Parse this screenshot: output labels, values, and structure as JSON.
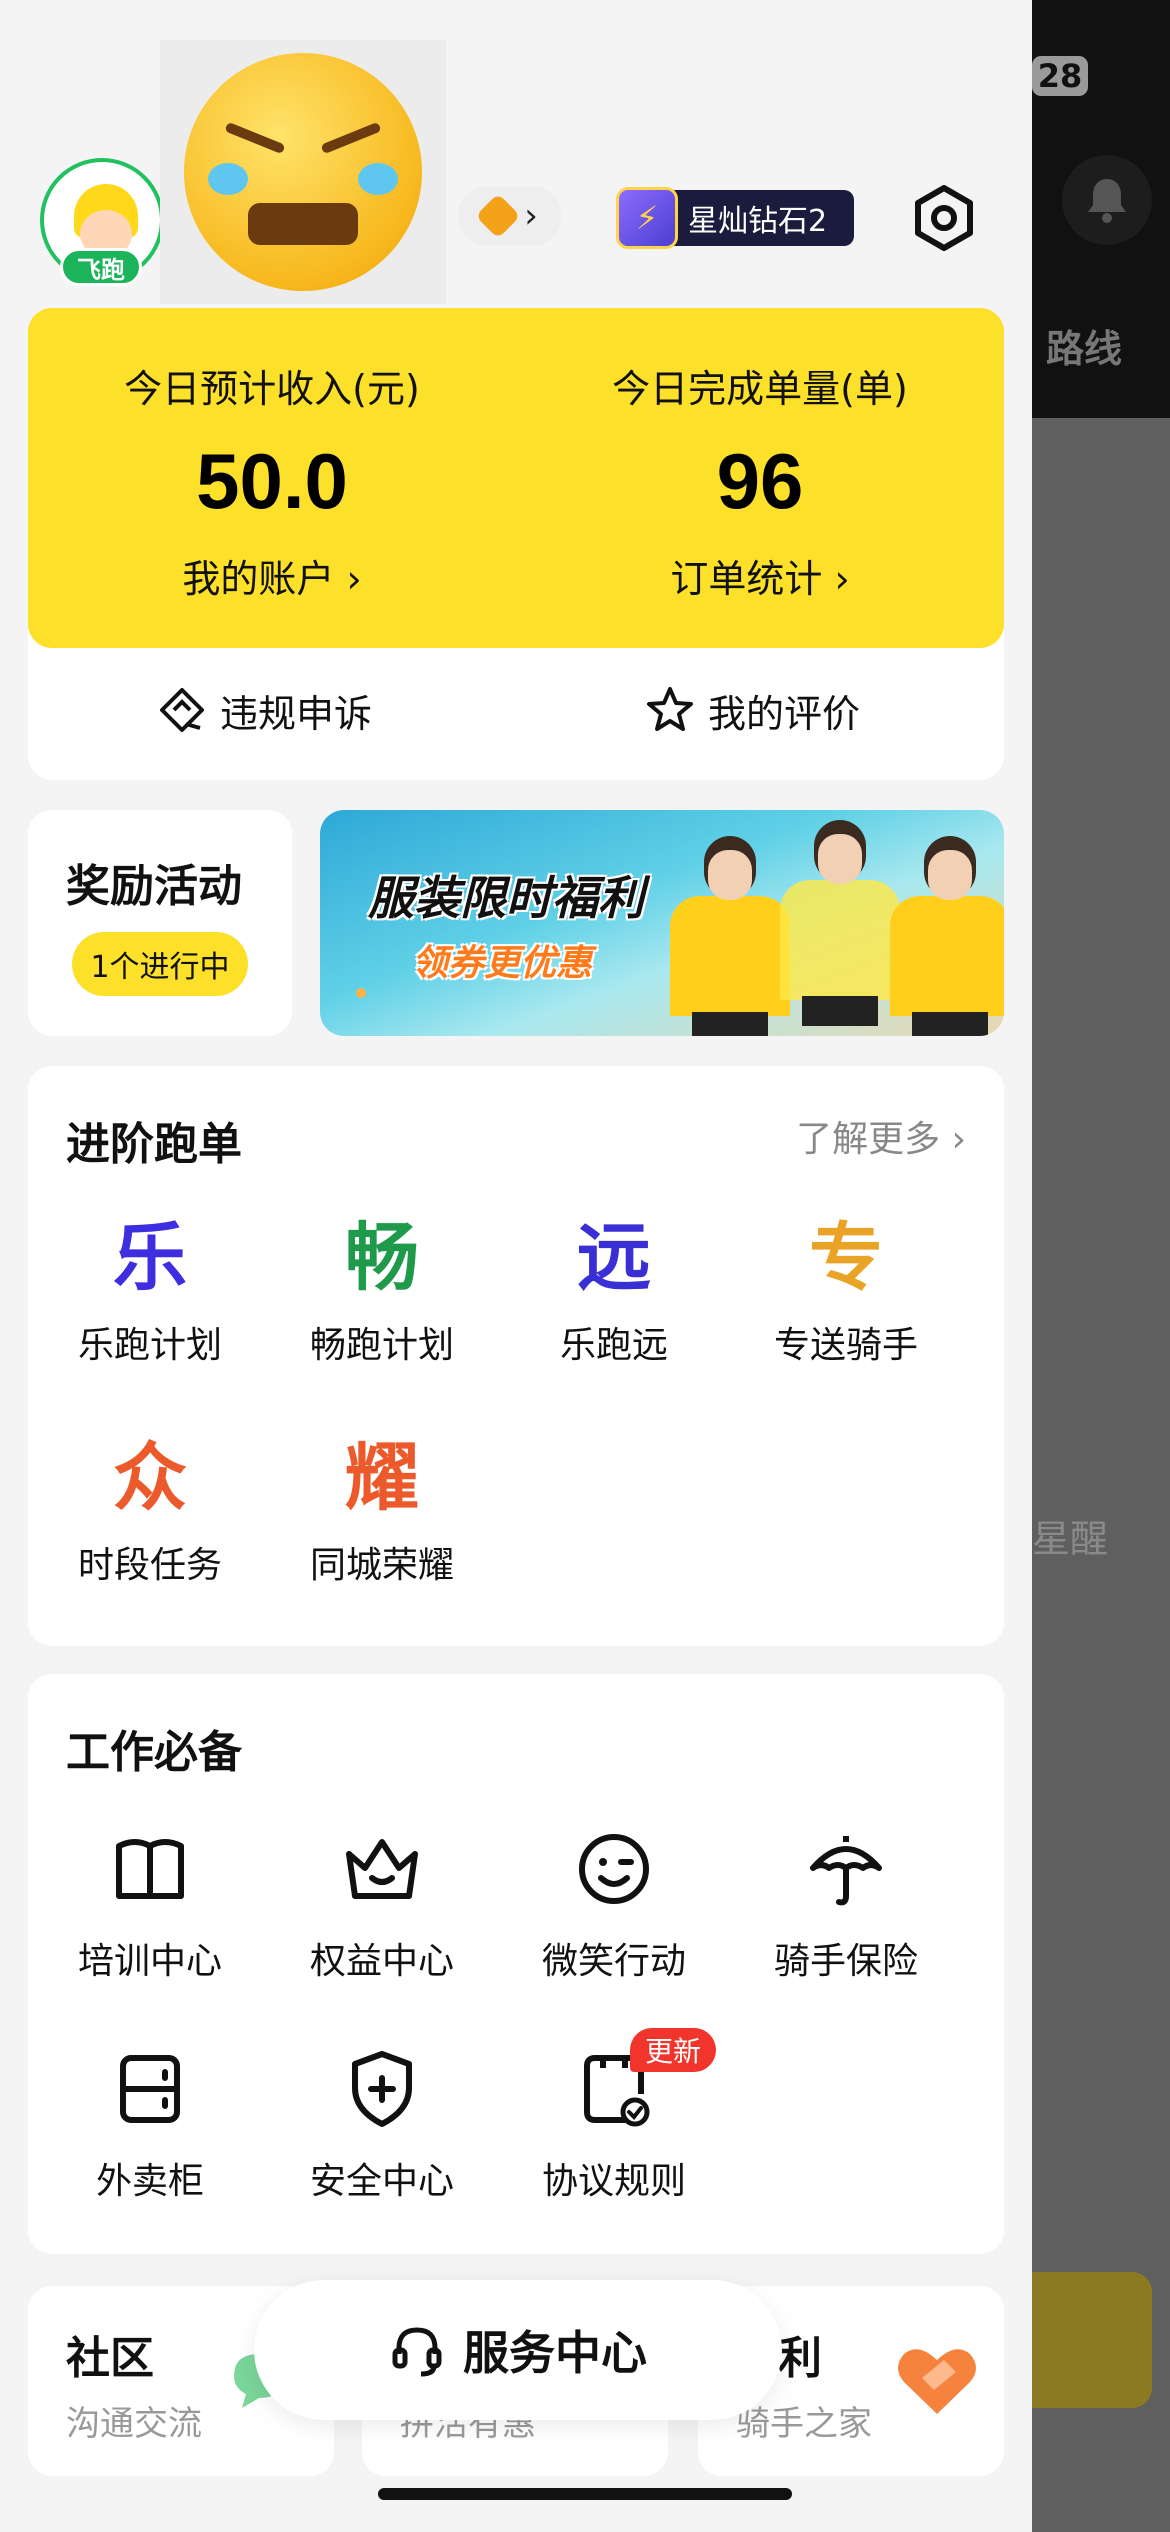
{
  "underlay": {
    "status_battery": "28",
    "route_text": "路线",
    "remind_text": "星醒"
  },
  "header": {
    "avatar_badge": "飞跑",
    "rank_label": "星灿钻石2",
    "level_chevron": "›"
  },
  "stats": {
    "income_label": "今日预计收入(元)",
    "income_value": "50.0",
    "account_link": "我的账户 ›",
    "orders_label": "今日完成单量(单)",
    "orders_value": "96",
    "orders_link": "订单统计 ›"
  },
  "actions": {
    "appeal": "违规申诉",
    "reviews": "我的评价"
  },
  "reward": {
    "title": "奖励活动",
    "pill": "1个进行中"
  },
  "banner": {
    "headline": "服装限时福利",
    "subline": "领券更优惠"
  },
  "advanced": {
    "title": "进阶跑单",
    "more": "了解更多 ›",
    "items": [
      {
        "glyph": "乐",
        "label": "乐跑计划",
        "color": "#3d2ee0"
      },
      {
        "glyph": "畅",
        "label": "畅跑计划",
        "color": "#1f9a4a"
      },
      {
        "glyph": "远",
        "label": "乐跑远",
        "color": "#3a2fd4"
      },
      {
        "glyph": "专",
        "label": "专送骑手",
        "color": "#e9a428"
      },
      {
        "glyph": "众",
        "label": "时段任务",
        "color": "#ec5a2c"
      },
      {
        "glyph": "耀",
        "label": "同城荣耀",
        "color": "#ec5a2c"
      }
    ]
  },
  "essentials": {
    "title": "工作必备",
    "items": [
      {
        "icon": "book-icon",
        "label": "培训中心"
      },
      {
        "icon": "crown-icon",
        "label": "权益中心"
      },
      {
        "icon": "smile-icon",
        "label": "微笑行动"
      },
      {
        "icon": "umbrella-icon",
        "label": "骑手保险"
      },
      {
        "icon": "locker-icon",
        "label": "外卖柜"
      },
      {
        "icon": "shield-plus-icon",
        "label": "安全中心"
      },
      {
        "icon": "document-check-icon",
        "label": "协议规则"
      }
    ],
    "new_badge": "更新"
  },
  "bottom": {
    "community_title": "社区",
    "community_sub": "沟通交流",
    "middle_sub": "拼活有惠",
    "welfare_title": "利",
    "welfare_sub": "骑手之家"
  },
  "service": {
    "label": "服务中心"
  }
}
